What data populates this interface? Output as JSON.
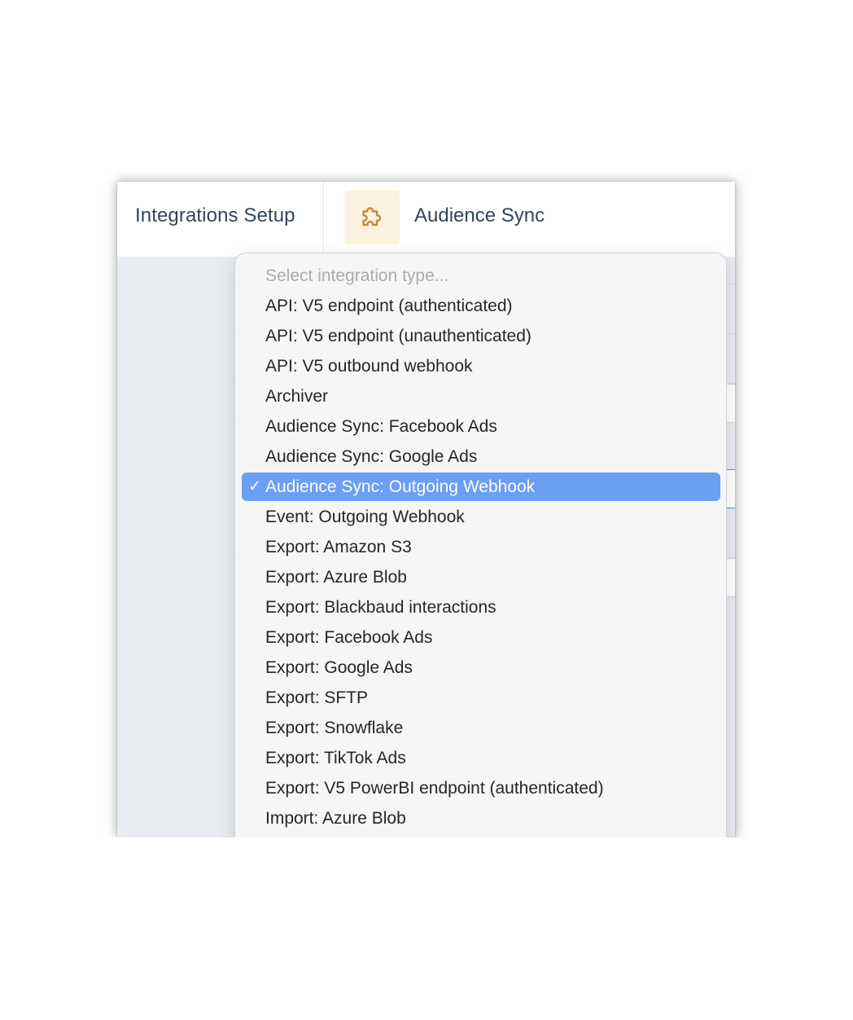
{
  "header": {
    "title": "Integrations Setup",
    "subtitle": "Audience Sync",
    "icon": "puzzle-piece-icon",
    "icon_color": "#c08a3e",
    "icon_tile_color": "#fdf2df"
  },
  "dropdown": {
    "placeholder": "Select integration type...",
    "selected_index": 6,
    "selected_color": "#6a9ff4",
    "check_mark": "✓",
    "options": [
      "API: V5 endpoint (authenticated)",
      "API: V5 endpoint (unauthenticated)",
      "API: V5 outbound webhook",
      "Archiver",
      "Audience Sync: Facebook Ads",
      "Audience Sync: Google Ads",
      "Audience Sync: Outgoing Webhook",
      "Event: Outgoing Webhook",
      "Export: Amazon S3",
      "Export: Azure Blob",
      "Export: Blackbaud interactions",
      "Export: Facebook Ads",
      "Export: Google Ads",
      "Export: SFTP",
      "Export: Snowflake",
      "Export: TikTok Ads",
      "Export: V5 PowerBI endpoint (authenticated)",
      "Import: Azure Blob"
    ]
  }
}
